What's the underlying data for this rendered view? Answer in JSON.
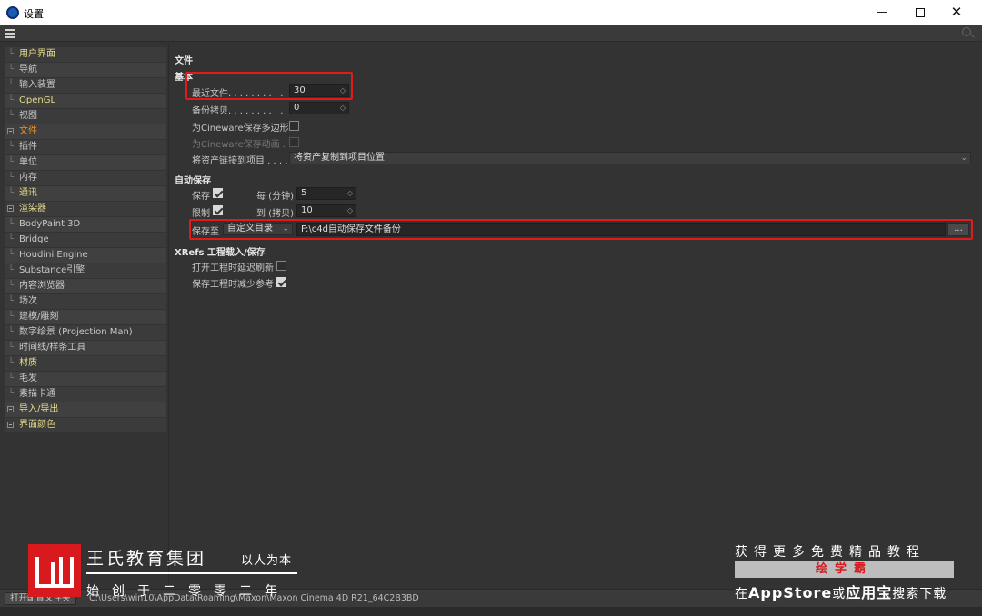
{
  "window": {
    "title": "设置",
    "minimize": "—",
    "close": "✕"
  },
  "sidebar": {
    "items": [
      {
        "label": "用户界面",
        "style": "yellow"
      },
      {
        "label": "导航",
        "style": ""
      },
      {
        "label": "输入装置",
        "style": ""
      },
      {
        "label": "OpenGL",
        "style": "yellow"
      },
      {
        "label": "视图",
        "style": ""
      },
      {
        "label": "文件",
        "style": "active"
      },
      {
        "label": "插件",
        "style": ""
      },
      {
        "label": "单位",
        "style": ""
      },
      {
        "label": "内存",
        "style": ""
      },
      {
        "label": "通讯",
        "style": "yellow"
      },
      {
        "label": "渲染器",
        "style": "yellow"
      },
      {
        "label": "BodyPaint 3D",
        "style": ""
      },
      {
        "label": "Bridge",
        "style": ""
      },
      {
        "label": "Houdini Engine",
        "style": ""
      },
      {
        "label": "Substance引擎",
        "style": ""
      },
      {
        "label": "内容浏览器",
        "style": ""
      },
      {
        "label": "场次",
        "style": ""
      },
      {
        "label": "建模/雕刻",
        "style": ""
      },
      {
        "label": "数字绘景 (Projection Man)",
        "style": ""
      },
      {
        "label": "时间线/样条工具",
        "style": ""
      },
      {
        "label": "材质",
        "style": "yellow"
      },
      {
        "label": "毛发",
        "style": ""
      },
      {
        "label": "素描卡通",
        "style": ""
      },
      {
        "label": "导入/导出",
        "style": "yellow"
      },
      {
        "label": "界面颜色",
        "style": "yellow"
      }
    ]
  },
  "main": {
    "section_title": "文件",
    "basic": {
      "heading": "基本",
      "recent_files_label": "最近文件. . . . . . . . . .",
      "recent_files_value": "30",
      "backup_copies_label": "备份拷贝. . . . . . . . . .",
      "backup_copies_value": "0",
      "cineware_poly_label": "为Cineware保存多边形",
      "cineware_anim_label": "为Cineware保存动画 .",
      "link_assets_label": "将资产链接到项目 . . . .",
      "link_assets_value": "将资产复制到项目位置"
    },
    "autosave": {
      "heading": "自动保存",
      "save_label": "保存",
      "every_label": "每 (分钟)",
      "every_value": "5",
      "limit_label": "限制",
      "to_label": "到 (拷贝)",
      "to_value": "10",
      "save_to_label": "保存至",
      "save_to_option": "自定义目录",
      "save_path": "F:\\c4d自动保存文件备份",
      "browse_label": "..."
    },
    "xrefs": {
      "heading": "XRefs 工程载入/保存",
      "delay_refresh_label": "打开工程时延迟刷新",
      "reduce_refs_label": "保存工程时减少参考"
    }
  },
  "statusbar": {
    "open_folder_label": "打开配置文件夹",
    "path": "C:\\Users\\win10\\AppData\\Roaming\\Maxon\\Maxon Cinema 4D R21_64C2B3BD"
  },
  "watermark_left": {
    "company": "王氏教育集团",
    "slogan": "以人为本",
    "founded": "始创于二零零二年"
  },
  "watermark_right": {
    "line1": "获得更多免费精品教程",
    "line2": "绘学霸",
    "line3_a": "在",
    "line3_b": "AppStore",
    "line3_c": "或",
    "line3_d": "应用宝",
    "line3_e": "搜索下载"
  },
  "colors": {
    "accent_orange": "#f28c28",
    "yellow_label": "#e6dc8a",
    "highlight_red": "#e01b1b"
  }
}
